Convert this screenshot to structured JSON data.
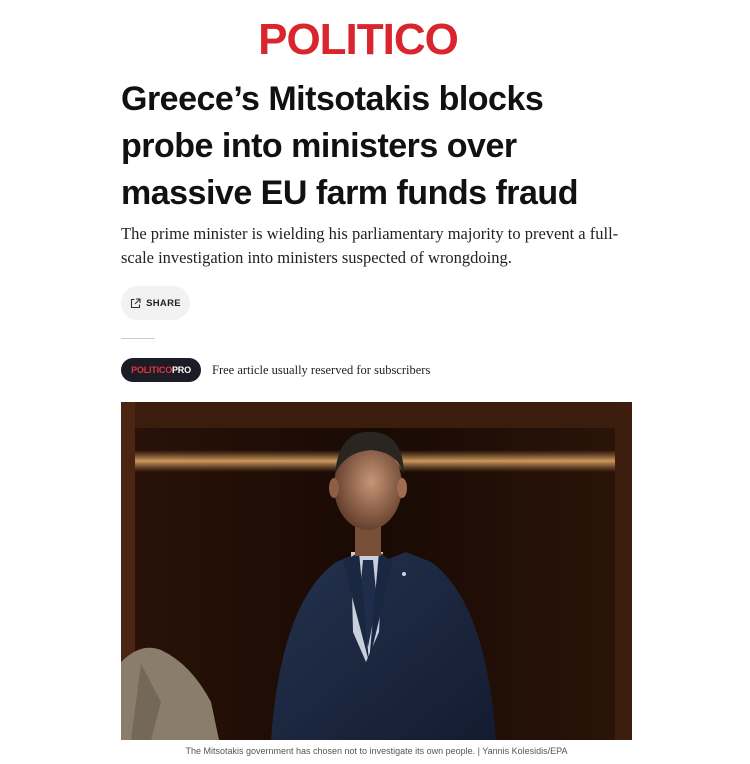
{
  "brand": {
    "logo_text": "POLITICO",
    "color": "#d9262e"
  },
  "article": {
    "headline": "Greece’s Mitsotakis blocks probe into ministers over massive EU farm funds fraud",
    "deck": "The prime minister is wielding his parliamentary majority to prevent a full-scale investigation into ministers suspected of wrongdoing."
  },
  "share": {
    "label": "SHARE",
    "icon": "share-icon"
  },
  "pro_badge": {
    "brand_part": "POLITICO",
    "pro_part": "PRO"
  },
  "subscriber_note": "Free article usually reserved for subscribers",
  "photo": {
    "caption": "The Mitsotakis government has chosen not to investigate its own people. | Yannis Kolesidis/EPA"
  }
}
